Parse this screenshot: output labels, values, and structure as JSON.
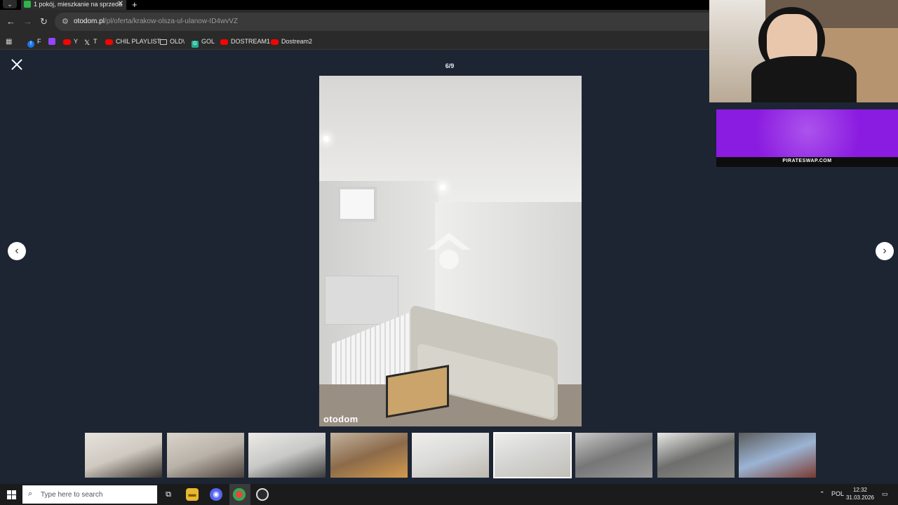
{
  "browser": {
    "tab_title": "1 pokój, mieszkanie na sprzeda",
    "url_host": "otodom.pl",
    "url_path": "/pl/oferta/krakow-olsza-ul-ulanow-ID4wvVZ",
    "bookmarks": [
      {
        "label": "F",
        "icon_color": "#1877f2"
      },
      {
        "label": "",
        "icon_color": "#9146ff"
      },
      {
        "label": "Y",
        "icon_color": "#ff0000"
      },
      {
        "label": "T",
        "icon_color": "#000000"
      },
      {
        "label": "CHIL PLAYLIST",
        "icon_color": "#ff0000"
      },
      {
        "label": "OLD\\",
        "icon_color": "folder"
      },
      {
        "label": "GOL",
        "icon_color": "#1fae8f"
      },
      {
        "label": "DOSTREAM1",
        "icon_color": "#ff0000"
      },
      {
        "label": "Dostream2",
        "icon_color": "#ff0000"
      }
    ]
  },
  "gallery": {
    "counter": "6/9",
    "brand": "otodom",
    "current_index": 6,
    "total": 9,
    "thumbnails": [
      {
        "name": "kitchen-1",
        "colors": [
          "#cfc9c0",
          "#3a342f",
          "#e6e3dd"
        ]
      },
      {
        "name": "kitchen-2",
        "colors": [
          "#b9b2a8",
          "#4a413a",
          "#d9d4cc"
        ]
      },
      {
        "name": "hallway",
        "colors": [
          "#c8c8c6",
          "#3b3b3b",
          "#ecebe8"
        ]
      },
      {
        "name": "room-door",
        "colors": [
          "#8c6a4a",
          "#d39a4e",
          "#c2b49f"
        ]
      },
      {
        "name": "living-room-1",
        "colors": [
          "#dadad8",
          "#bdb8ae",
          "#efeeec"
        ]
      },
      {
        "name": "living-room-2",
        "colors": [
          "#d3d3d1",
          "#c2beb6",
          "#eeeeec"
        ]
      },
      {
        "name": "bathroom-1",
        "colors": [
          "#767676",
          "#9a9a9a",
          "#c9c9c9"
        ]
      },
      {
        "name": "bathroom-2",
        "colors": [
          "#6e6e6c",
          "#8e8e8c",
          "#e8e8e6"
        ]
      },
      {
        "name": "building",
        "colors": [
          "#9bb4d4",
          "#7a3a30",
          "#5c5c5c"
        ]
      }
    ]
  },
  "taskbar": {
    "search_placeholder": "Type here to search",
    "language": "POL",
    "time": "12:32",
    "date": "31.03.2026"
  },
  "overlay": {
    "banner_text": "PIRATESWAP.COM"
  },
  "colors": {
    "gallery_bg": "#1d2533",
    "accent_green": "#2fb34b",
    "banner_purple": "#8a1be0"
  }
}
